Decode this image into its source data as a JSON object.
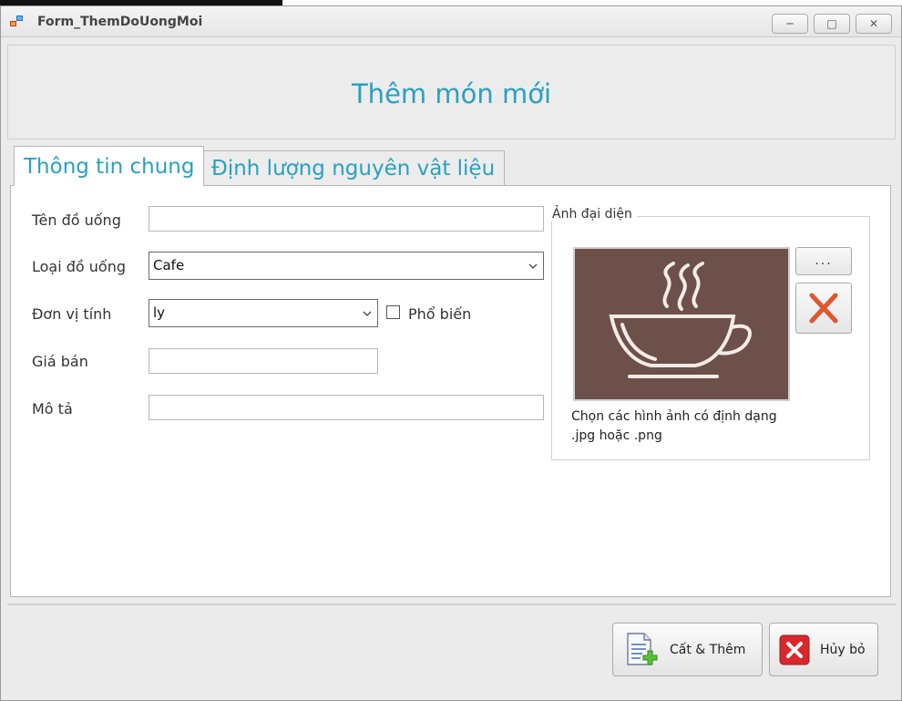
{
  "window": {
    "title": "Form_ThemDoUongMoi"
  },
  "header": {
    "title": "Thêm món mới"
  },
  "tabs": [
    {
      "label": "Thông tin chung",
      "active": true
    },
    {
      "label": "Định lượng nguyên vật liệu",
      "active": false
    }
  ],
  "form": {
    "name": {
      "label": "Tên đồ uống",
      "value": ""
    },
    "type": {
      "label": "Loại đồ uống",
      "value": "Cafe"
    },
    "unit": {
      "label": "Đơn vị tính",
      "value": "ly"
    },
    "popular": {
      "label": "Phổ biến",
      "checked": false
    },
    "price": {
      "label": "Giá bán",
      "value": ""
    },
    "description": {
      "label": "Mô tả",
      "value": ""
    }
  },
  "image_group": {
    "title": "Ảnh đại diện",
    "browse_label": "...",
    "hint": "Chọn các hình ảnh có định dạng .jpg hoặc .png",
    "icon": "coffee-cup-icon",
    "background_color": "#6c5049"
  },
  "buttons": {
    "save_label": "Cất & Thêm",
    "cancel_label": "Hủy bỏ"
  },
  "colors": {
    "accent": "#2aa0c2",
    "delete": "#e0562f"
  }
}
